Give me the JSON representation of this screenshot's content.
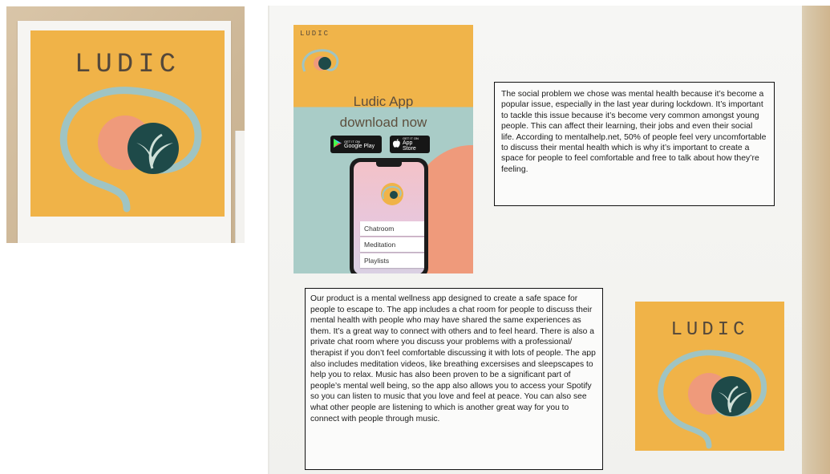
{
  "left_photo": {
    "logo_word": "LUDIC"
  },
  "right_photo": {
    "poster": {
      "brand": "LUDIC",
      "title": "Ludic App",
      "subtitle": "download now",
      "google_play_small": "GET IT ON",
      "google_play_label": "Google Play",
      "app_store_small": "GET IT ON",
      "app_store_label": "App Store",
      "phone_menu": [
        "Chatroom",
        "Meditation",
        "Playlists"
      ]
    },
    "social_problem_text": "The social problem we chose was mental health because it’s become a popular issue, especially in the last year during lockdown. It’s important to tackle this issue because it’s become very common amongst young people. This can affect their learning, their jobs and even their social life. According to mentalhelp.net, 50% of people feel very uncomfortable to discuss their mental health which is why it’s important to create a space for people to feel comfortable and free to talk about how they’re feeling.",
    "product_text": "Our product is a mental wellness app designed to create a safe space for people to escape to. The app includes a chat room for people to discuss their mental health with people who may have shared the same experiences as them. It’s a great way to connect with others and to feel heard. There is also a private chat room where you discuss your problems with a professional/ therapist if you don’t feel comfortable discussing it with lots of people. The app also includes meditation videos, like breathing excersises and sleepscapes to help you to relax. Music has also been proven to be a significant part of people’s mental well being, so the app also allows you to access your Spotify so you can listen to music that you love and feel at peace. You can also see what other people are listening to which is another great way for you to connect with people through music.",
    "logo_word": "LUDIC"
  },
  "colors": {
    "mustard": "#f0b348",
    "teal_line": "#9fc4c3",
    "coral": "#ef9a7b",
    "dark_teal": "#1e4a49",
    "leaf": "#cfe0d8"
  },
  "icons": [
    "brain-leaf-logo-icon",
    "google-play-icon",
    "apple-icon"
  ]
}
